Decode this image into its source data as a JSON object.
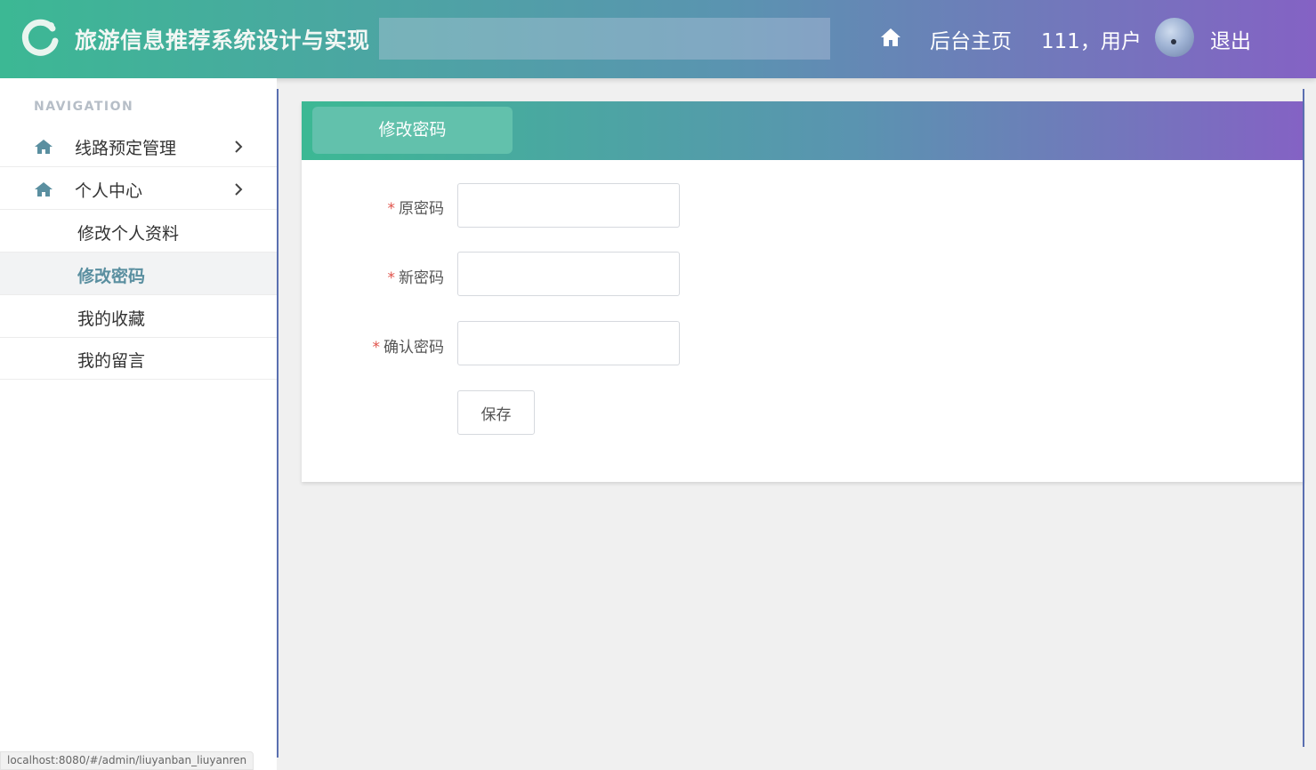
{
  "header": {
    "app_title": "旅游信息推荐系统设计与实现",
    "home_link": "后台主页",
    "user_greeting": "111，用户",
    "logout": "退出"
  },
  "sidebar": {
    "caption": "NAVIGATION",
    "items": [
      {
        "label": "线路预定管理",
        "icon": "home-icon"
      },
      {
        "label": "个人中心",
        "icon": "home-icon"
      }
    ],
    "sub_items": [
      {
        "label": "修改个人资料",
        "active": false
      },
      {
        "label": "修改密码",
        "active": true
      },
      {
        "label": "我的收藏",
        "active": false
      },
      {
        "label": "我的留言",
        "active": false
      }
    ]
  },
  "panel": {
    "tab_title": "修改密码",
    "required_mark": "*",
    "fields": [
      {
        "label": "原密码",
        "value": ""
      },
      {
        "label": "新密码",
        "value": ""
      },
      {
        "label": "确认密码",
        "value": ""
      }
    ],
    "save_label": "保存"
  },
  "status_bar": {
    "url": "localhost:8080/#/admin/liuyanban_liuyanren"
  },
  "colors": {
    "gradient_start": "#3cb894",
    "gradient_end": "#8462c4",
    "active_menu_text": "#5a8fa0",
    "required": "#e0524a"
  }
}
